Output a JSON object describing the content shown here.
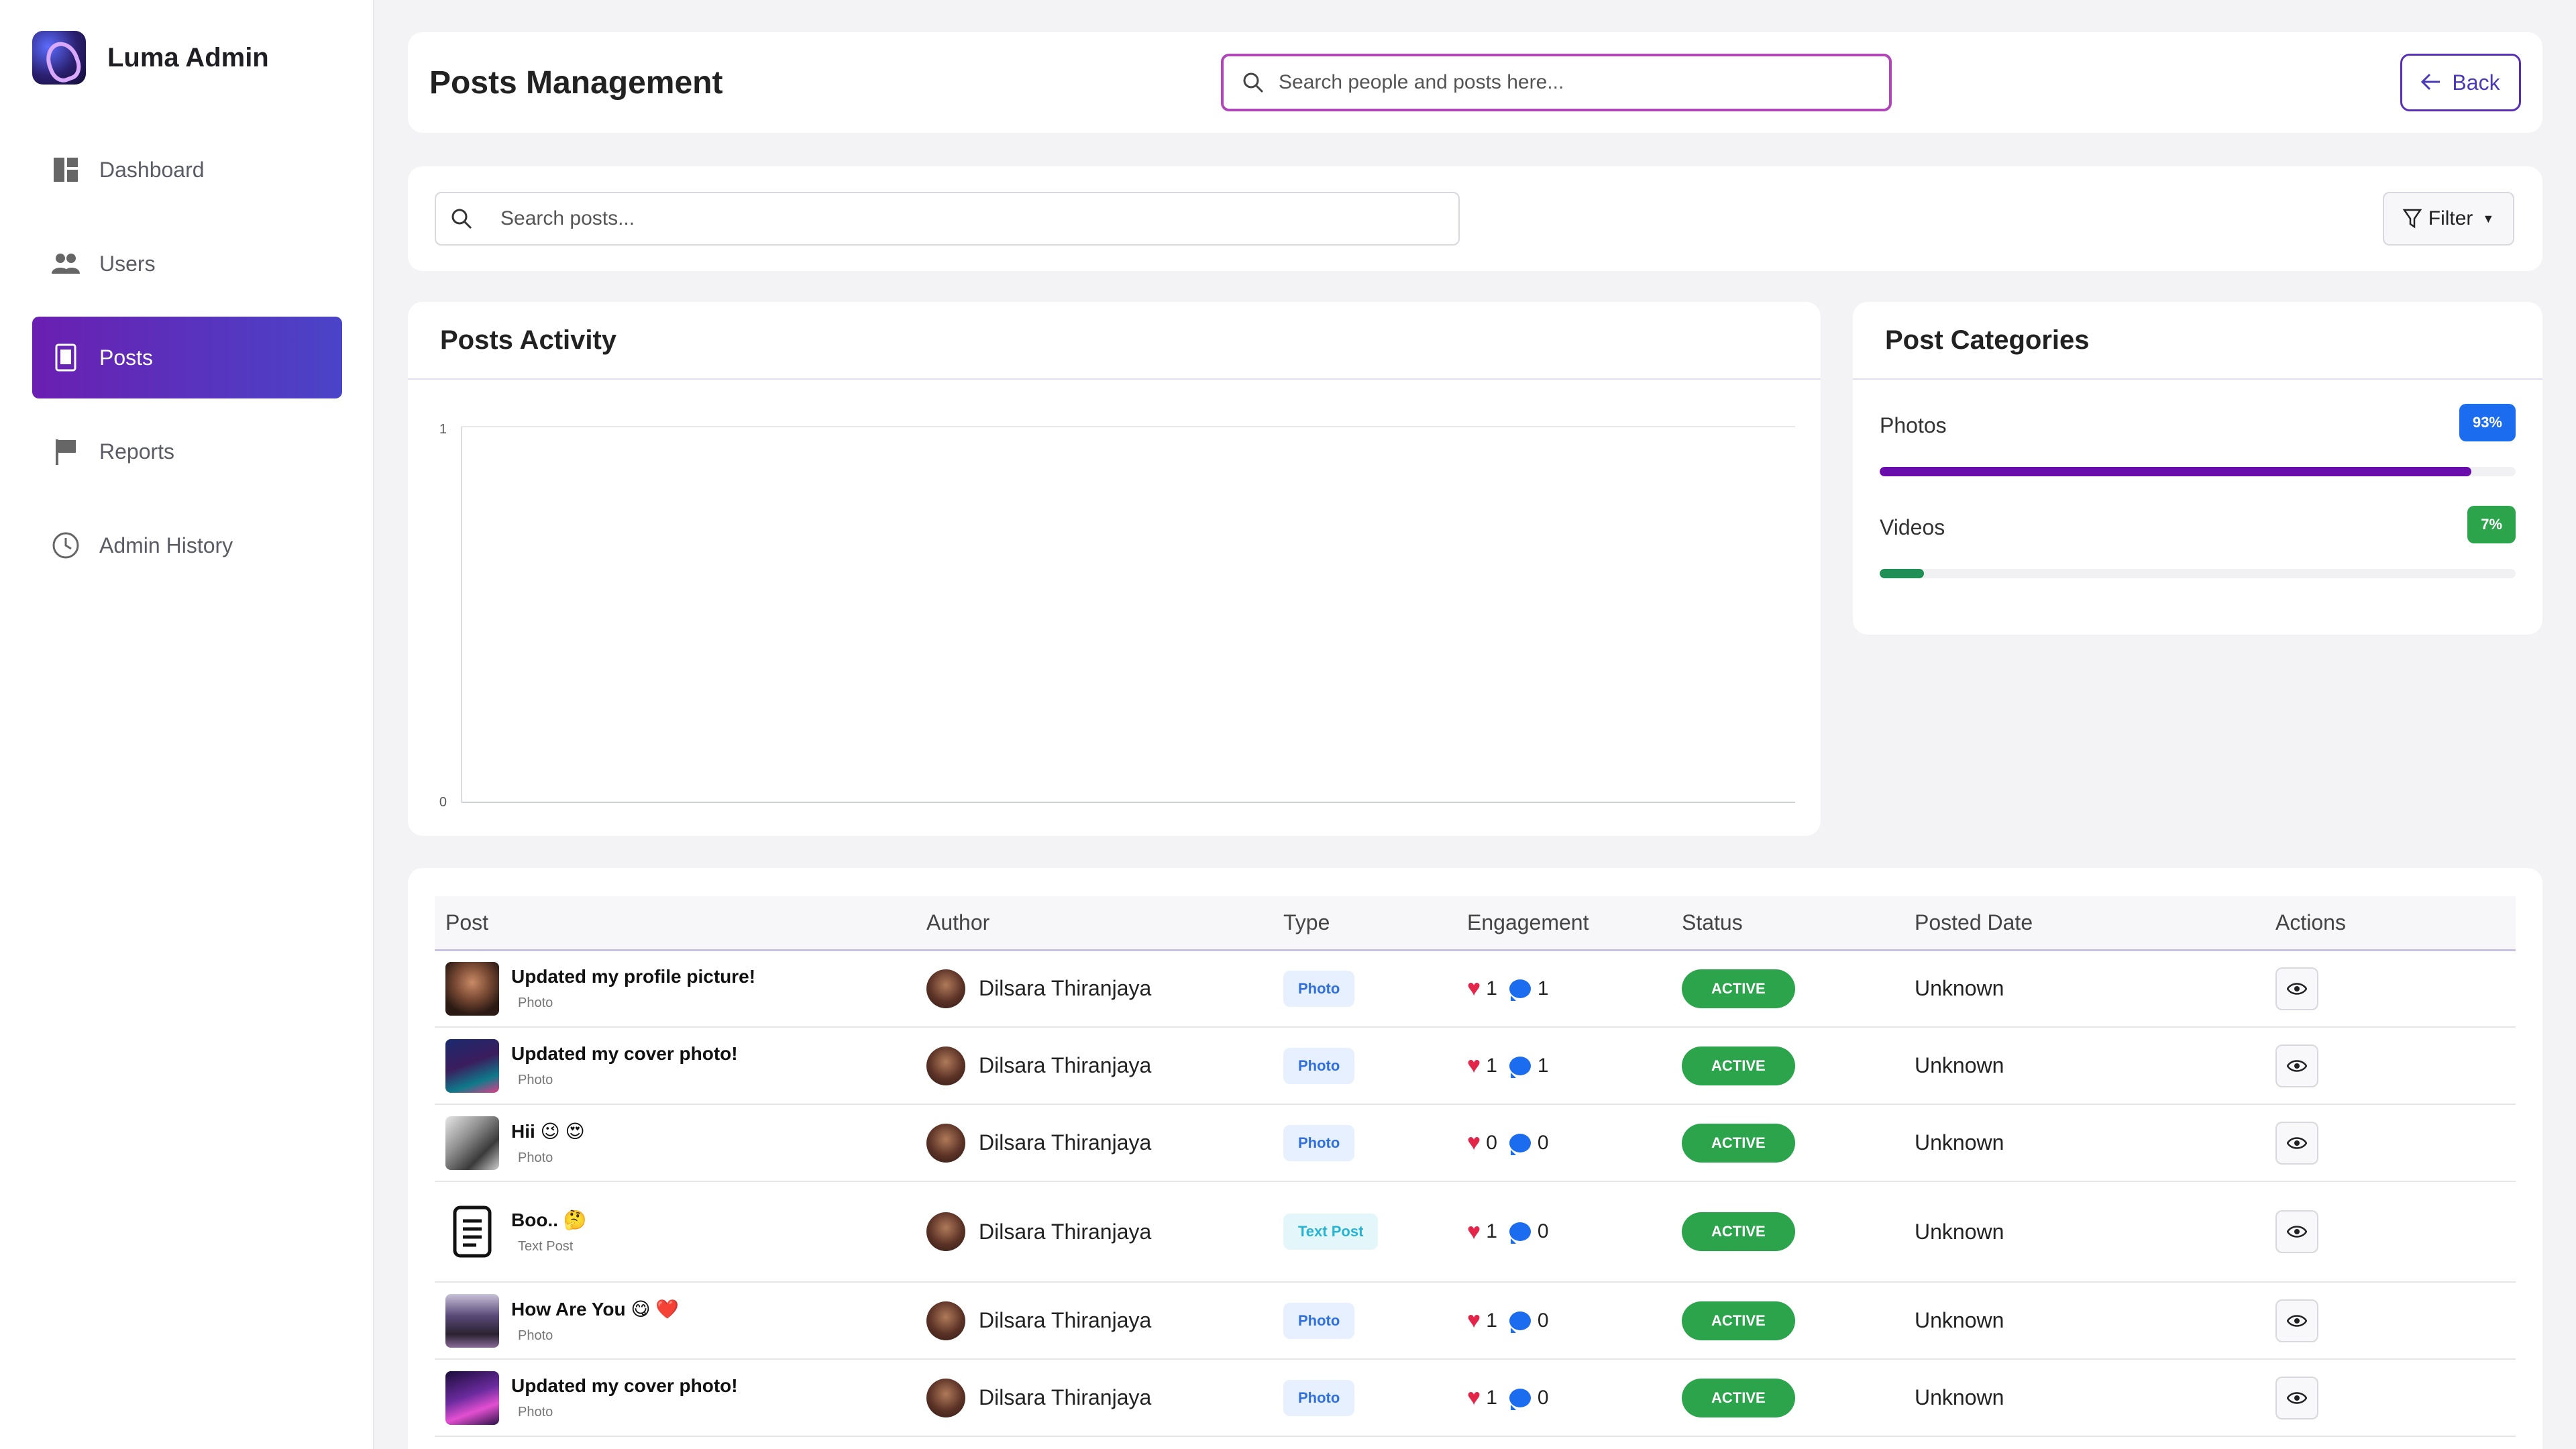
{
  "app": {
    "name": "Luma Admin"
  },
  "sidebar": {
    "items": [
      {
        "label": "Dashboard",
        "icon": "dashboard-icon",
        "active": false
      },
      {
        "label": "Users",
        "icon": "users-icon",
        "active": false
      },
      {
        "label": "Posts",
        "icon": "posts-icon",
        "active": true
      },
      {
        "label": "Reports",
        "icon": "flag-icon",
        "active": false
      },
      {
        "label": "Admin History",
        "icon": "clock-icon",
        "active": false
      }
    ]
  },
  "header": {
    "title": "Posts Management",
    "search_placeholder": "Search people and posts here...",
    "back_label": "Back"
  },
  "filters": {
    "search_placeholder": "Search posts...",
    "filter_label": "Filter"
  },
  "activity": {
    "title": "Posts Activity"
  },
  "chart_data": {
    "type": "line",
    "title": "Posts Activity",
    "x": [],
    "series": [],
    "yticks": [
      "1",
      "0"
    ],
    "ylim": [
      0,
      1
    ],
    "grid": false
  },
  "categories": {
    "title": "Post Categories",
    "items": [
      {
        "label": "Photos",
        "percent_label": "93%",
        "percent": 93,
        "color": "#6a0dad",
        "badge_color": "#1c6cf0"
      },
      {
        "label": "Videos",
        "percent_label": "7%",
        "percent": 7,
        "color": "#1f8f55",
        "badge_color": "#2ca44b"
      }
    ]
  },
  "table": {
    "columns": [
      "Post",
      "Author",
      "Type",
      "Engagement",
      "Status",
      "Posted Date",
      "Actions"
    ],
    "rows": [
      {
        "title": "Updated my profile picture!",
        "subtype": "Photo",
        "author": "Dilsara Thiranjaya",
        "type": "Photo",
        "likes": "1",
        "comments": "1",
        "status": "ACTIVE",
        "date": "Unknown",
        "thumb": "portrait"
      },
      {
        "title": "Updated my cover photo!",
        "subtype": "Photo",
        "author": "Dilsara Thiranjaya",
        "type": "Photo",
        "likes": "1",
        "comments": "1",
        "status": "ACTIVE",
        "date": "Unknown",
        "thumb": "city-night"
      },
      {
        "title": "Hii 😉 😍",
        "subtype": "Photo",
        "author": "Dilsara Thiranjaya",
        "type": "Photo",
        "likes": "0",
        "comments": "0",
        "status": "ACTIVE",
        "date": "Unknown",
        "thumb": "anime-gray"
      },
      {
        "title": "Boo.. 🤔",
        "subtype": "Text Post",
        "author": "Dilsara Thiranjaya",
        "type": "Text Post",
        "likes": "1",
        "comments": "0",
        "status": "ACTIVE",
        "date": "Unknown",
        "thumb": "document"
      },
      {
        "title": "How Are You 😋 ❤️",
        "subtype": "Photo",
        "author": "Dilsara Thiranjaya",
        "type": "Photo",
        "likes": "1",
        "comments": "0",
        "status": "ACTIVE",
        "date": "Unknown",
        "thumb": "group"
      },
      {
        "title": "Updated my cover photo!",
        "subtype": "Photo",
        "author": "Dilsara Thiranjaya",
        "type": "Photo",
        "likes": "1",
        "comments": "0",
        "status": "ACTIVE",
        "date": "Unknown",
        "thumb": "purple-car"
      }
    ]
  }
}
